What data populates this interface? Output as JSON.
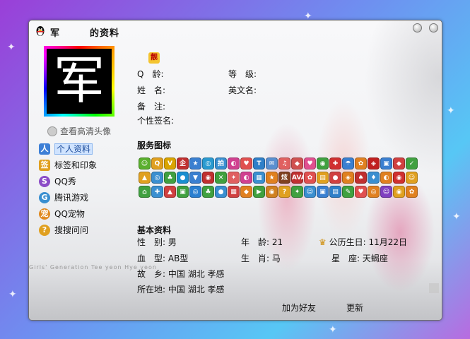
{
  "window": {
    "title_prefix": "军",
    "title_suffix": "的资料",
    "close_glyph": "×"
  },
  "avatar": {
    "char": "军"
  },
  "view_hd_avatar": "查看高清头像",
  "nav": [
    {
      "label": "个人资料",
      "color": "#3d7fd6",
      "glyph": "人"
    },
    {
      "label": "标签和印象",
      "color": "#e0a020",
      "glyph": "签"
    },
    {
      "label": "QQ秀",
      "color": "#8b4cc7",
      "glyph": "S"
    },
    {
      "label": "腾讯游戏",
      "color": "#3a8fd0",
      "glyph": "G"
    },
    {
      "label": "QQ宠物",
      "color": "#e08a20",
      "glyph": "宠"
    },
    {
      "label": "搜搜问问",
      "color": "#e0a020",
      "glyph": "?"
    }
  ],
  "level_badge": "靓",
  "profile": {
    "qq_label": "Q　龄:",
    "level_label": "等　级:",
    "name_label": "姓　名:",
    "english_name_label": "英文名:",
    "note_label": "备　注:",
    "signature_label": "个性签名:"
  },
  "service_icons_title": "服务图标",
  "service_icons": [
    {
      "g": "☺",
      "c": "#5aaf2e"
    },
    {
      "g": "Q",
      "c": "#e0a020"
    },
    {
      "g": "V",
      "c": "#d9a400"
    },
    {
      "g": "企",
      "c": "#c03030"
    },
    {
      "g": "★",
      "c": "#3a7fd0"
    },
    {
      "g": "◎",
      "c": "#2a9ad0"
    },
    {
      "g": "拍",
      "c": "#3a8fd0"
    },
    {
      "g": "◐",
      "c": "#d04090"
    },
    {
      "g": "♥",
      "c": "#e05050"
    },
    {
      "g": "T",
      "c": "#2f7fc8"
    },
    {
      "g": "✉",
      "c": "#5a8fd0"
    },
    {
      "g": "♫",
      "c": "#e06060"
    },
    {
      "g": "◆",
      "c": "#d05050"
    },
    {
      "g": "♥",
      "c": "#e05090"
    },
    {
      "g": "◉",
      "c": "#40a040"
    },
    {
      "g": "✚",
      "c": "#d03030"
    },
    {
      "g": "☂",
      "c": "#3a7fd0"
    },
    {
      "g": "✿",
      "c": "#e08020"
    },
    {
      "g": "◈",
      "c": "#c02020"
    },
    {
      "g": "▣",
      "c": "#3a7fd0"
    },
    {
      "g": "◆",
      "c": "#d04040"
    },
    {
      "g": "✓",
      "c": "#40a040"
    },
    {
      "g": "▲",
      "c": "#e0a020"
    },
    {
      "g": "◎",
      "c": "#3a8fd0"
    },
    {
      "g": "♣",
      "c": "#40a040"
    },
    {
      "g": "●",
      "c": "#1a8fd0"
    },
    {
      "g": "▼",
      "c": "#3a7fd0"
    },
    {
      "g": "◉",
      "c": "#c03030"
    },
    {
      "g": "✕",
      "c": "#40a040"
    },
    {
      "g": "✦",
      "c": "#e06060"
    },
    {
      "g": "◐",
      "c": "#d04090"
    },
    {
      "g": "▦",
      "c": "#3a8fd0"
    },
    {
      "g": "★",
      "c": "#e08020"
    },
    {
      "g": "炫",
      "c": "#804020"
    },
    {
      "g": "AVA",
      "c": "#c03030"
    },
    {
      "g": "✿",
      "c": "#e05050"
    },
    {
      "g": "▤",
      "c": "#e0a020"
    },
    {
      "g": "●",
      "c": "#d04040"
    },
    {
      "g": "◈",
      "c": "#e08020"
    },
    {
      "g": "♠",
      "c": "#c03030"
    },
    {
      "g": "♦",
      "c": "#3a8fd0"
    },
    {
      "g": "◐",
      "c": "#e08020"
    },
    {
      "g": "◉",
      "c": "#d03030"
    },
    {
      "g": "☺",
      "c": "#e0a020"
    },
    {
      "g": "⌂",
      "c": "#40a040"
    },
    {
      "g": "✚",
      "c": "#3a8fd0"
    },
    {
      "g": "▲",
      "c": "#d04040"
    },
    {
      "g": "▣",
      "c": "#40a040"
    },
    {
      "g": "◎",
      "c": "#2a7fd0"
    },
    {
      "g": "♣",
      "c": "#40a040"
    },
    {
      "g": "●",
      "c": "#3a8fd0"
    },
    {
      "g": "▦",
      "c": "#d04040"
    },
    {
      "g": "◆",
      "c": "#e08020"
    },
    {
      "g": "▶",
      "c": "#40a040"
    },
    {
      "g": "◉",
      "c": "#d08020"
    },
    {
      "g": "?",
      "c": "#e0a020"
    },
    {
      "g": "✦",
      "c": "#40a040"
    },
    {
      "g": "☺",
      "c": "#3a8fd0"
    },
    {
      "g": "▣",
      "c": "#3a7fd0"
    },
    {
      "g": "▤",
      "c": "#2f7fc8"
    },
    {
      "g": "✎",
      "c": "#40a040"
    },
    {
      "g": "♥",
      "c": "#e05050"
    },
    {
      "g": "◎",
      "c": "#e08020"
    },
    {
      "g": "☺",
      "c": "#8040c0"
    },
    {
      "g": "◉",
      "c": "#e0a020"
    },
    {
      "g": "✿",
      "c": "#e08020"
    }
  ],
  "basic_title": "基本资料",
  "basic": {
    "gender_label": "性　别:",
    "gender": "男",
    "age_label": "年　龄:",
    "age": "21",
    "birthday_label": "公历生日:",
    "birthday": "11月22日",
    "blood_label": "血　型:",
    "blood": "AB型",
    "zodiac_label": "生　肖:",
    "zodiac": "马",
    "constellation_label": "星　座:",
    "constellation": "天蝎座",
    "hometown_label": "故　乡:",
    "hometown": "中国 湖北 孝感",
    "location_label": "所在地:",
    "location": "中国 湖北 孝感"
  },
  "buttons": {
    "add_friend": "加为好友",
    "update": "更新"
  },
  "watermark": "Girls' Generation    Tee yeon  Hye yeon"
}
